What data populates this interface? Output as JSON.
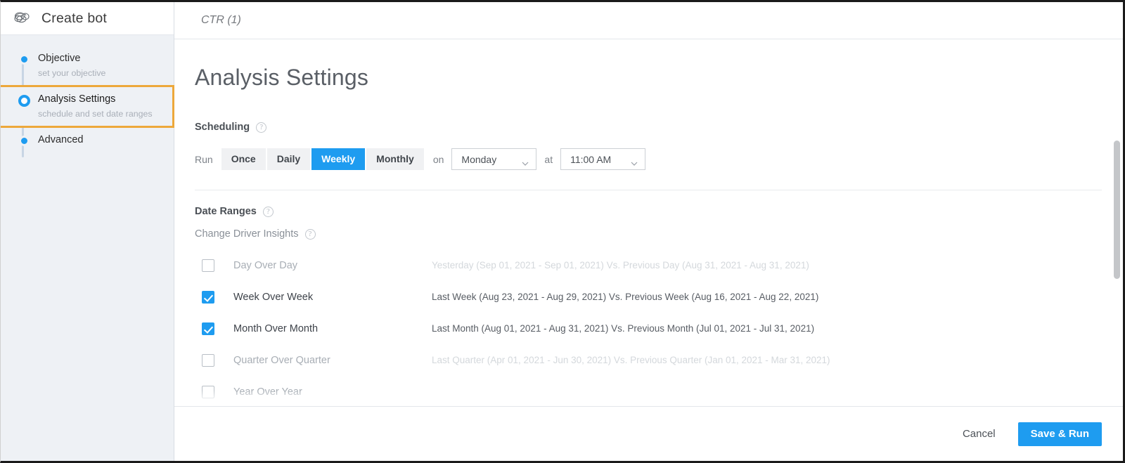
{
  "sidebar": {
    "logo_icon": "brain-knot-logo-icon",
    "title": "Create bot",
    "steps": [
      {
        "title": "Objective",
        "subtitle": "set your objective",
        "state": "complete"
      },
      {
        "title": "Analysis Settings",
        "subtitle": "schedule and set date ranges",
        "state": "active"
      },
      {
        "title": "Advanced",
        "subtitle": "",
        "state": "upcoming"
      }
    ]
  },
  "tabbar": {
    "active_tab": "CTR (1)"
  },
  "page": {
    "title": "Analysis Settings"
  },
  "scheduling": {
    "title": "Scheduling",
    "help_icon": "question-mark-circle-icon",
    "run_label": "Run",
    "frequencies": [
      "Once",
      "Daily",
      "Weekly",
      "Monthly"
    ],
    "selected_frequency": "Weekly",
    "on_label": "on",
    "day_value": "Monday",
    "at_label": "at",
    "time_value": "11:00 AM",
    "chevron_icon": "chevron-down-icon"
  },
  "date_ranges": {
    "title": "Date Ranges",
    "help_icon": "question-mark-circle-icon",
    "subsection_title": "Change Driver Insights",
    "subsection_help_icon": "question-mark-circle-icon",
    "rows": [
      {
        "label": "Day Over Day",
        "checked": false,
        "enabled": false,
        "description": "Yesterday (Sep 01, 2021 - Sep 01, 2021) Vs. Previous Day (Aug 31, 2021 - Aug 31, 2021)"
      },
      {
        "label": "Week Over Week",
        "checked": true,
        "enabled": true,
        "description": "Last Week (Aug 23, 2021 - Aug 29, 2021) Vs. Previous Week (Aug 16, 2021 - Aug 22, 2021)"
      },
      {
        "label": "Month Over Month",
        "checked": true,
        "enabled": true,
        "description": "Last Month (Aug 01, 2021 - Aug 31, 2021) Vs. Previous Month (Jul 01, 2021 - Jul 31, 2021)"
      },
      {
        "label": "Quarter Over Quarter",
        "checked": false,
        "enabled": false,
        "description": "Last Quarter (Apr 01, 2021 - Jun 30, 2021) Vs. Previous Quarter (Jan 01, 2021 - Mar 31, 2021)"
      },
      {
        "label": "Year Over Year",
        "checked": false,
        "enabled": false,
        "description": ""
      }
    ]
  },
  "footer": {
    "cancel_label": "Cancel",
    "save_label": "Save & Run"
  },
  "colors": {
    "accent_blue": "#1e9cf0",
    "active_step_border": "#eda83b",
    "sidebar_bg": "#eef1f5"
  }
}
